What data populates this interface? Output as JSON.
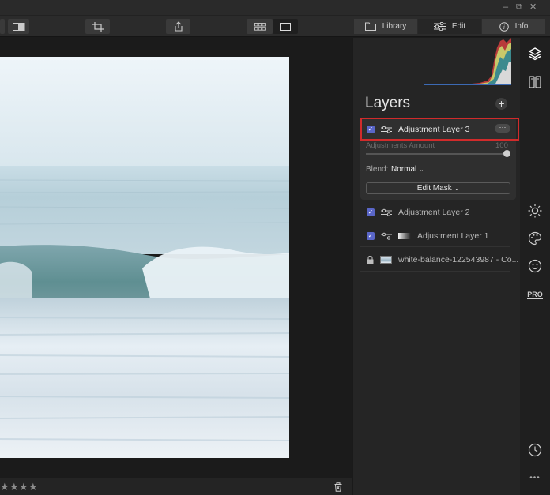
{
  "window": {
    "minimize": "–",
    "restore": "⧉",
    "close": "✕"
  },
  "toolbar": {
    "modes": [
      {
        "label": "Library",
        "icon": "library-icon"
      },
      {
        "label": "Edit",
        "icon": "sliders-icon"
      },
      {
        "label": "Info",
        "icon": "info-icon"
      }
    ],
    "active_mode": "Edit"
  },
  "panel": {
    "title": "Layers",
    "add_symbol": "+",
    "more_symbol": "···",
    "layers": [
      {
        "name": "Adjustment Layer 3",
        "checked": true,
        "selected": true
      },
      {
        "name": "Adjustment Layer 2",
        "checked": true
      },
      {
        "name": "Adjustment Layer 1",
        "checked": true
      },
      {
        "name": "white-balance-122543987 - Co...",
        "locked": true
      }
    ],
    "adjustments_amount_label": "Adjustments Amount",
    "adjustments_amount_value": "100",
    "adjustments_amount": 100,
    "blend_label": "Blend:",
    "blend_value": "Normal",
    "edit_mask_label": "Edit Mask"
  },
  "sidebar": {
    "icons": [
      "layers-icon",
      "presets-icon",
      "essentials-sun-icon",
      "creative-palette-icon",
      "portrait-face-icon",
      "professional-icon",
      "history-clock-icon",
      "more-icon"
    ],
    "pro_label": "PRO",
    "more_label": "•••"
  },
  "rating": {
    "stars": 4
  },
  "colors": {
    "selection_outline": "#d12b2b",
    "checkbox": "#5a66c8"
  }
}
